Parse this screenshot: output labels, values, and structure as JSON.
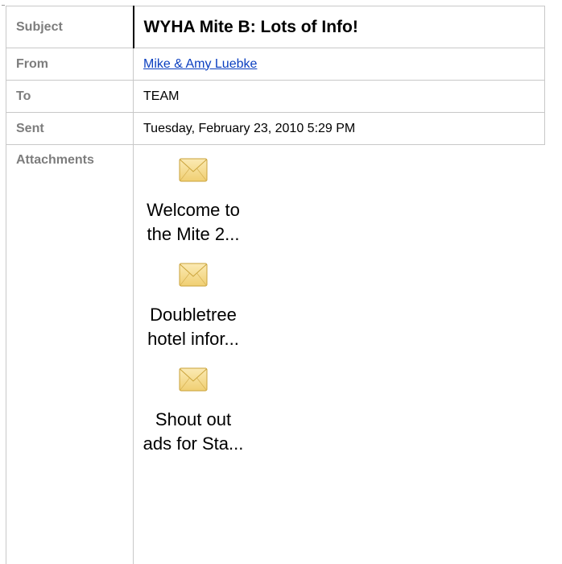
{
  "headers": {
    "subject": {
      "label": "Subject",
      "value": "WYHA Mite B:  Lots of Info!"
    },
    "from": {
      "label": "From",
      "value": "Mike & Amy Luebke"
    },
    "to": {
      "label": "To",
      "value": "TEAM"
    },
    "sent": {
      "label": "Sent",
      "value": "Tuesday, February 23, 2010 5:29 PM"
    },
    "attachments_label": "Attachments"
  },
  "attachments": [
    {
      "line1": "Welcome to",
      "line2": "the Mite 2...",
      "icon": "envelope-icon"
    },
    {
      "line1": "Doubletree",
      "line2": "hotel infor...",
      "icon": "envelope-icon"
    },
    {
      "line1": "Shout out",
      "line2": "ads for Sta...",
      "icon": "envelope-icon"
    }
  ],
  "colors": {
    "label_text": "#7d7d7d",
    "link": "#0b3fc0",
    "border": "#c8c8c8",
    "envelope_fill": "#f6dc8e",
    "envelope_stroke": "#c9a23a"
  }
}
